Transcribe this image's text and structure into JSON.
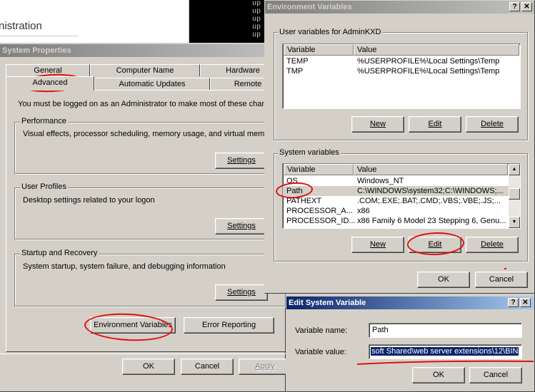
{
  "bg_window": {
    "title_fragment": "nistration"
  },
  "console": {
    "lines": [
      "up",
      "up",
      "up",
      "up",
      "up"
    ]
  },
  "sysprops": {
    "title": "System Properties",
    "tabs_back": [
      "General",
      "Computer Name",
      "Hardware"
    ],
    "tabs_front": [
      "Advanced",
      "Automatic Updates",
      "Remote"
    ],
    "admin_note": "You must be logged on as an Administrator to make most of these changes.",
    "performance": {
      "label": "Performance",
      "desc": "Visual effects, processor scheduling, memory usage, and virtual memory",
      "button": "Settings"
    },
    "profiles": {
      "label": "User Profiles",
      "desc": "Desktop settings related to your logon",
      "button": "Settings"
    },
    "startup": {
      "label": "Startup and Recovery",
      "desc": "System startup, system failure, and debugging information",
      "button": "Settings"
    },
    "env_button": "Environment Variables",
    "error_button": "Error Reporting",
    "ok": "OK",
    "cancel": "Cancel",
    "apply": "Apply"
  },
  "envvars": {
    "title": "Environment Variables",
    "user_group": "User variables for AdminKXD",
    "col_variable": "Variable",
    "col_value": "Value",
    "user_rows": [
      {
        "name": "TEMP",
        "value": "%USERPROFILE%\\Local Settings\\Temp"
      },
      {
        "name": "TMP",
        "value": "%USERPROFILE%\\Local Settings\\Temp"
      }
    ],
    "user_buttons": {
      "new": "New",
      "edit": "Edit",
      "delete": "Delete"
    },
    "system_group": "System variables",
    "system_rows": [
      {
        "name": "OS",
        "value": "Windows_NT"
      },
      {
        "name": "Path",
        "value": "C:\\WINDOWS\\system32;C:\\WINDOWS;..."
      },
      {
        "name": "PATHEXT",
        "value": ".COM;.EXE;.BAT;.CMD;.VBS;.VBE;.JS;..."
      },
      {
        "name": "PROCESSOR_A...",
        "value": "x86"
      },
      {
        "name": "PROCESSOR_ID...",
        "value": "x86 Family 6 Model 23 Stepping 6, Genu..."
      }
    ],
    "system_buttons": {
      "new": "New",
      "edit": "Edit",
      "delete": "Delete"
    },
    "ok": "OK",
    "cancel": "Cancel"
  },
  "editvar": {
    "title": "Edit System Variable",
    "name_label": "Variable name:",
    "name_value": "Path",
    "value_label": "Variable value:",
    "value_value": "soft Shared\\web server extensions\\12\\BIN",
    "ok": "OK",
    "cancel": "Cancel"
  },
  "colors": {
    "active_title": "#0a246a",
    "face": "#d4d0c8",
    "annotation": "#e01010",
    "selection": "#0a246a"
  }
}
